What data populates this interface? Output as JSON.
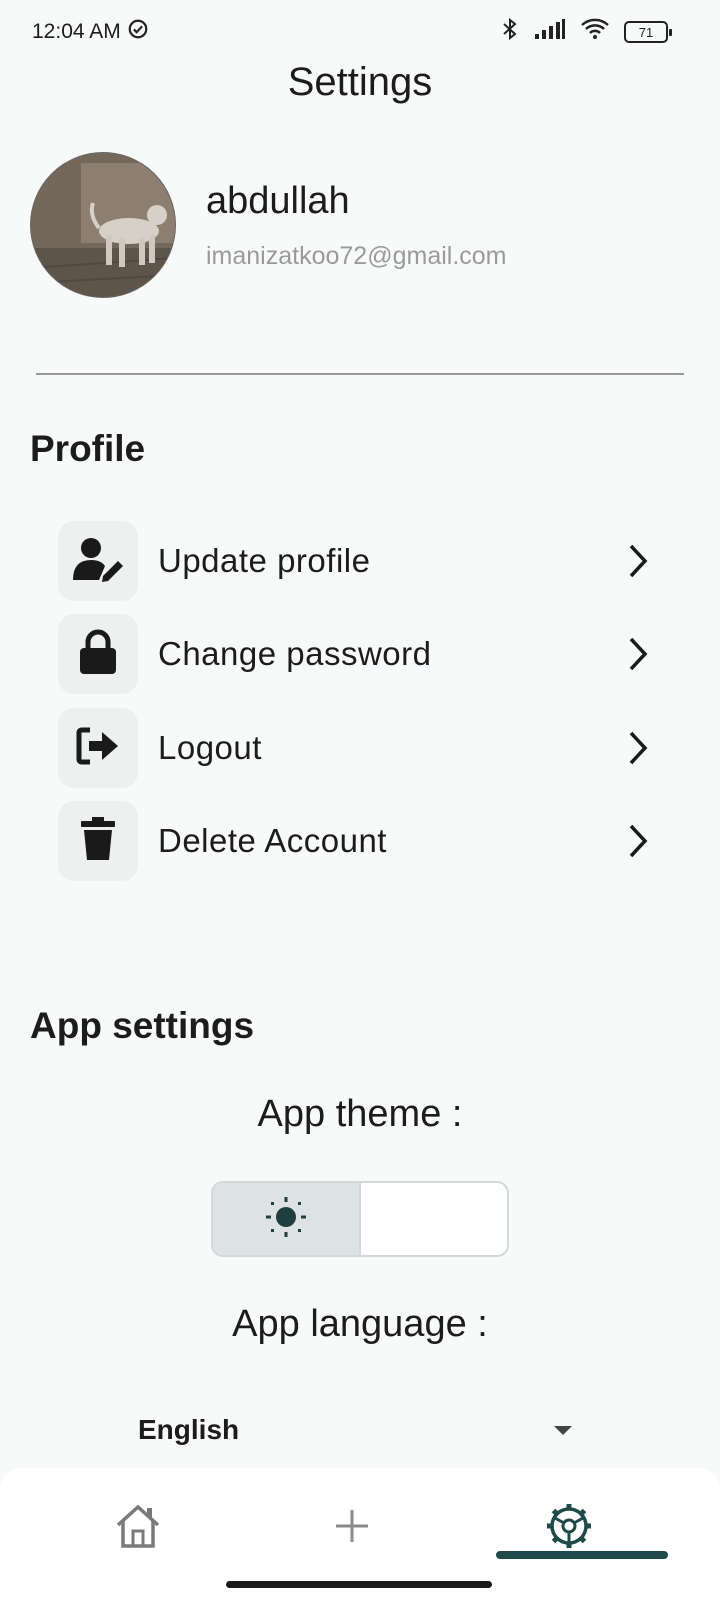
{
  "status_bar": {
    "time": "12:04 AM",
    "battery": "71"
  },
  "header": {
    "title": "Settings"
  },
  "user": {
    "name": "abdullah",
    "email": "imanizatkoo72@gmail.com"
  },
  "profile_section": {
    "title": "Profile",
    "items": [
      {
        "label": "Update profile",
        "icon": "user-edit-icon"
      },
      {
        "label": "Change password",
        "icon": "lock-icon"
      },
      {
        "label": "Logout",
        "icon": "logout-icon"
      },
      {
        "label": "Delete Account",
        "icon": "trash-icon"
      }
    ]
  },
  "app_settings": {
    "title": "App settings",
    "theme_label": "App theme :",
    "theme_selected": "light",
    "language_label": "App language :",
    "language_value": "English"
  },
  "bottom_nav": {
    "items": [
      {
        "name": "home",
        "icon": "home-icon"
      },
      {
        "name": "add",
        "icon": "plus-icon"
      },
      {
        "name": "settings",
        "icon": "settings-gear-icon",
        "active": true
      }
    ]
  },
  "colors": {
    "accent": "#1f4a4a",
    "background": "#f8fafa",
    "muted_text": "#9a9a9a"
  }
}
